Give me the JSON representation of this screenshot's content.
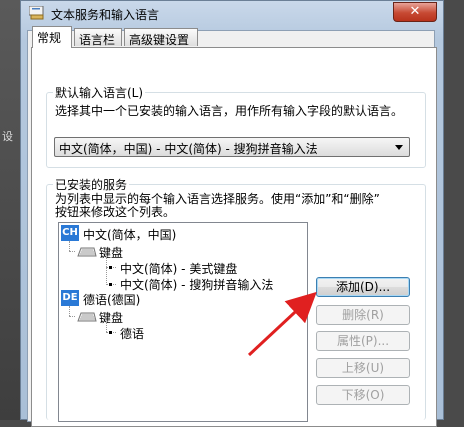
{
  "background": {
    "partial_text": "设"
  },
  "window": {
    "title": "文本服务和输入语言",
    "close_label": "✕"
  },
  "tabs": [
    {
      "label": "常规",
      "active": true
    },
    {
      "label": "语言栏",
      "active": false
    },
    {
      "label": "高级键设置",
      "active": false
    }
  ],
  "default_lang": {
    "legend": "默认输入语言(L)",
    "description": "选择其中一个已安装的输入语言，用作所有输入字段的默认语言。",
    "selected": "中文(简体，中国) - 中文(简体) - 搜狗拼音输入法"
  },
  "installed": {
    "legend": "已安装的服务",
    "description_line1": "为列表中显示的每个输入语言选择服务。使用“添加”和“删除”",
    "description_line2": "按钮来修改这个列表。",
    "tree": {
      "lang1": {
        "code": "CH",
        "name": "中文(简体，中国)",
        "group": "键盘",
        "items": [
          "中文(简体) - 美式键盘",
          "中文(简体) - 搜狗拼音输入法"
        ]
      },
      "lang2": {
        "code": "DE",
        "name": "德语(德国)",
        "group": "键盘",
        "items": [
          "德语"
        ]
      }
    }
  },
  "buttons": {
    "add": "添加(D)...",
    "remove": "删除(R)",
    "properties": "属性(P)...",
    "move_up": "上移(U)",
    "move_down": "下移(O)"
  },
  "colors": {
    "annotation_arrow": "#e02020",
    "lang_icon": "#2a79d6",
    "close_button": "#c74a33"
  }
}
